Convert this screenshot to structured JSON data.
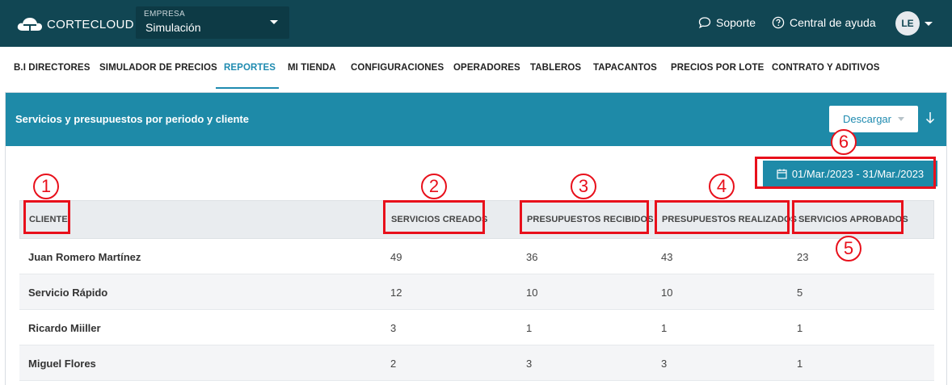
{
  "brand": {
    "name": "CORTECLOUD"
  },
  "company": {
    "label": "EMPRESA",
    "value": "Simulación"
  },
  "top_links": {
    "support": "Soporte",
    "help": "Central de ayuda"
  },
  "user": {
    "initials": "LE"
  },
  "nav": {
    "items": [
      "B.I DIRECTORES",
      "SIMULADOR DE PRECIOS",
      "REPORTES",
      "MI TIENDA",
      "CONFIGURACIONES",
      "OPERADORES",
      "TABLEROS",
      "TAPACANTOS",
      "PRECIOS POR LOTE",
      "CONTRATO Y ADITIVOS"
    ],
    "active": "REPORTES"
  },
  "panel": {
    "title": "Servicios y presupuestos por periodo y cliente",
    "download_label": "Descargar",
    "date_range": "01/Mar./2023 - 31/Mar./2023"
  },
  "table": {
    "headers": [
      "CLIENTE",
      "SERVICIOS CREADOS",
      "PRESUPUESTOS RECIBIDOS",
      "PRESUPUESTOS REALIZADOS",
      "SERVICIOS APROBADOS"
    ],
    "rows": [
      [
        "Juan Romero Martínez",
        "49",
        "36",
        "43",
        "23"
      ],
      [
        "Servicio Rápido",
        "12",
        "10",
        "10",
        "5"
      ],
      [
        "Ricardo Miiller",
        "3",
        "1",
        "1",
        "1"
      ],
      [
        "Miguel Flores",
        "2",
        "3",
        "3",
        "1"
      ]
    ]
  },
  "annotations": [
    "1",
    "2",
    "3",
    "4",
    "5",
    "6"
  ],
  "colors": {
    "topbar": "#114653",
    "accent": "#1e8aa8",
    "annotation": "#e8101b"
  }
}
